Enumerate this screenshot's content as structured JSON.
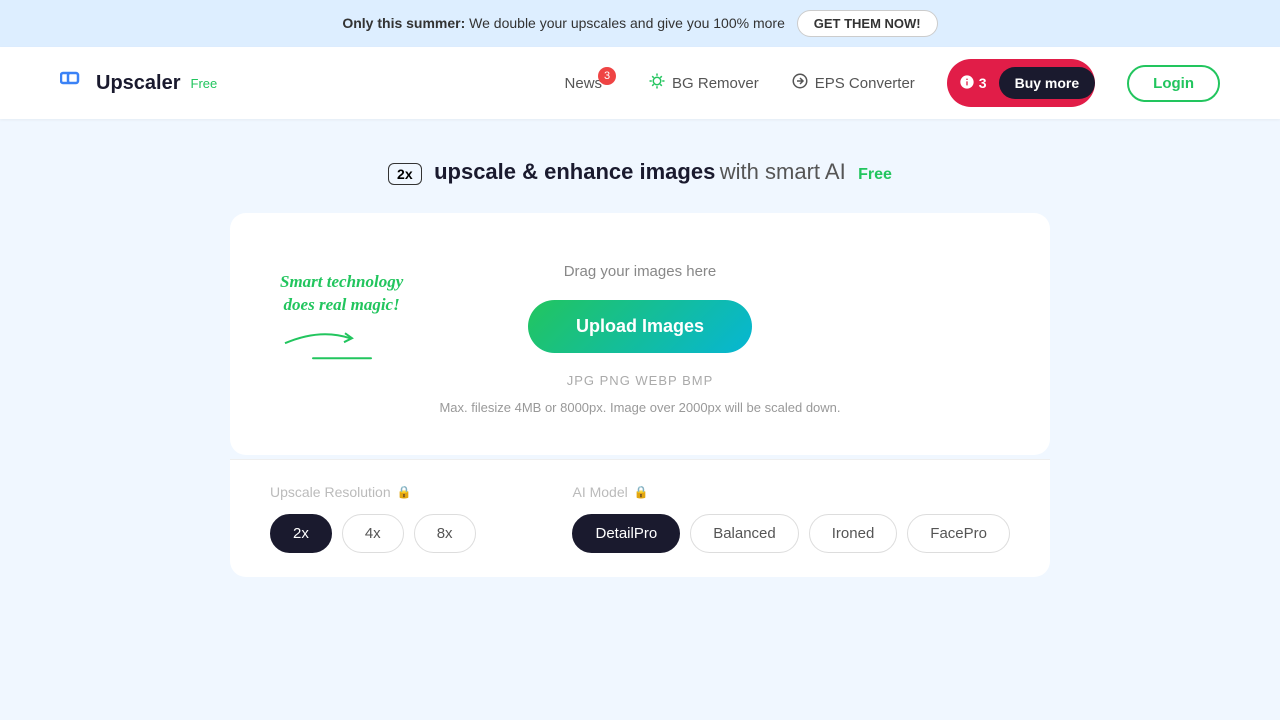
{
  "banner": {
    "text_bold": "Only this summer:",
    "text_normal": " We double your upscales and give you 100% more",
    "cta": "GET THEM NOW!"
  },
  "header": {
    "logo_text": "Upscaler",
    "logo_badge": "Free",
    "nav": [
      {
        "label": "News",
        "badge": "3",
        "icon": "news-icon"
      },
      {
        "label": "BG Remover",
        "icon": "bg-remover-icon"
      },
      {
        "label": "EPS Converter",
        "icon": "eps-converter-icon"
      }
    ],
    "credits_icon": "credits-icon",
    "credits_count": "3",
    "buy_more_label": "Buy more",
    "login_label": "Login"
  },
  "hero": {
    "tag": "2x",
    "title": "upscale & enhance images",
    "subtitle": " with smart AI",
    "free_label": "Free"
  },
  "upload": {
    "drag_text": "Drag your images here",
    "button_label": "Upload Images",
    "file_types": "JPG PNG WEBP BMP",
    "file_limit": "Max. filesize 4MB or 8000px. Image over 2000px will be scaled down.",
    "smart_text_line1": "Smart technology",
    "smart_text_line2": "does real magic!"
  },
  "settings": {
    "resolution_label": "Upscale Resolution",
    "resolution_options": [
      "2x",
      "4x",
      "8x"
    ],
    "resolution_active": "2x",
    "ai_model_label": "AI Model",
    "ai_model_options": [
      "DetailPro",
      "Balanced",
      "Ironed",
      "FacePro"
    ],
    "ai_model_active": "DetailPro"
  }
}
